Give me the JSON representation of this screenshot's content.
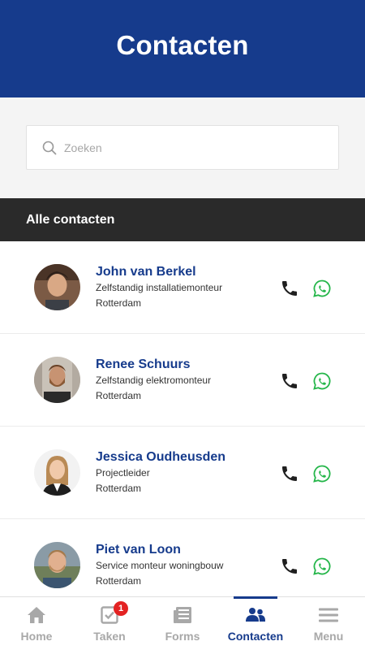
{
  "header": {
    "title": "Contacten"
  },
  "search": {
    "placeholder": "Zoeken",
    "value": ""
  },
  "section": {
    "title": "Alle contacten"
  },
  "contacts": [
    {
      "name": "John van Berkel",
      "role": "Zelfstandig installatiemonteur",
      "city": "Rotterdam"
    },
    {
      "name": "Renee Schuurs",
      "role": "Zelfstandig elektromonteur",
      "city": "Rotterdam"
    },
    {
      "name": "Jessica Oudheusden",
      "role": "Projectleider",
      "city": "Rotterdam"
    },
    {
      "name": "Piet van Loon",
      "role": "Service monteur woningbouw",
      "city": "Rotterdam"
    }
  ],
  "tabs": [
    {
      "label": "Home",
      "icon": "home-icon"
    },
    {
      "label": "Taken",
      "icon": "tasks-icon",
      "badge": "1"
    },
    {
      "label": "Forms",
      "icon": "forms-icon"
    },
    {
      "label": "Contacten",
      "icon": "contacts-icon",
      "active": true
    },
    {
      "label": "Menu",
      "icon": "menu-icon"
    }
  ],
  "colors": {
    "brand": "#163b8c",
    "section_bar": "#2a2a2a",
    "whatsapp": "#25b64a",
    "badge": "#e32222"
  }
}
